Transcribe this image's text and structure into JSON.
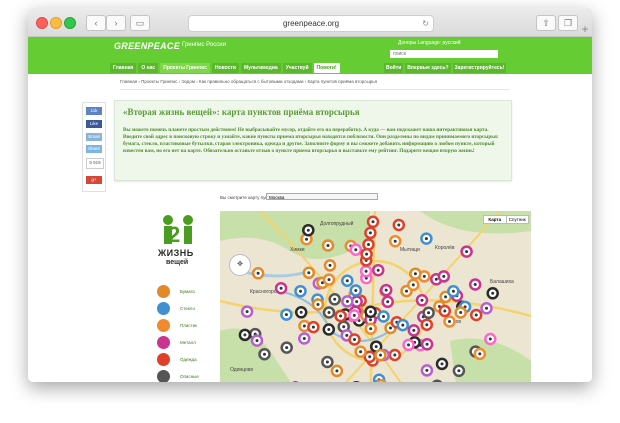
{
  "browser": {
    "url": "greenpeace.org",
    "back_icon": "chevron-left-icon",
    "forward_icon": "chevron-right-icon"
  },
  "header": {
    "logo": "GREENPEACE",
    "country": "Гринпис России",
    "top_links": "Доноры  Language: русский",
    "search_placeholder": "поиск",
    "brand_color": "#66cc33"
  },
  "nav": {
    "items": [
      "Главная",
      "О нас",
      "Проекты Гринпис",
      "Новости",
      "Мультимедиа",
      "Участвуй",
      "Помоги!"
    ],
    "right_items": [
      "Войти",
      "Впервые здесь?",
      "Зарегистрируйтесь!"
    ]
  },
  "breadcrumb": "Главная › Проекты Гринпис › Ээдом › Как правильно обращаться с бытовыми отходами › Карта пунктов приёма вторсырья",
  "share": {
    "like": "11k",
    "fb": "Like",
    "email": "Email",
    "share": "Share",
    "count": "5 919",
    "gplus": "g+"
  },
  "intro": {
    "title": "«Вторая жизнь вещей»: карта пунктов приёма вторсырья",
    "text": "Вы можете помочь планете простым действием! Не выбрасывайте мусор, отдайте его на переработку. А куда — вам подскажет наша интерактивная карта. Введите свой адрес в поисковую строку и узнайте, какие пункты приема вторсырья находятся поблизости. Они разделены по видам принимаемого вторсырья: бумага, стекло, пластиковые бутылки, старая электроника, одежда и другое. Заполните форму и вы сможете добавить информацию о любом пункте, который известен вам, но его нет на карте. Обязательно оставьте отзыв о пункте приема вторсырья и выставьте ему рейтинг. Подарите вещам вторую жизнь!"
  },
  "map": {
    "city_label": "Вы смотрите карту пунктов для",
    "city": "Москва",
    "type_map": "Карта",
    "type_sat": "Спутник",
    "places": [
      "Долгопрудный",
      "Мытищи",
      "Королёв",
      "Балашиха",
      "Химки",
      "Красногорск",
      "Реутов",
      "Люберцы",
      "Одинцово"
    ]
  },
  "logo2": {
    "num": "2",
    "line1": "ЖИЗНЬ",
    "line2": "вещей"
  },
  "legend": [
    {
      "label": "Бумага",
      "color": "#e08a2c"
    },
    {
      "label": "Стекло",
      "color": "#3f8fd1"
    },
    {
      "label": "Пластик",
      "color": "#f08a2e"
    },
    {
      "label": "Металл",
      "color": "#c8348e"
    },
    {
      "label": "Одежда",
      "color": "#e0402a"
    },
    {
      "label": "Опасные",
      "color": "#555555"
    }
  ]
}
